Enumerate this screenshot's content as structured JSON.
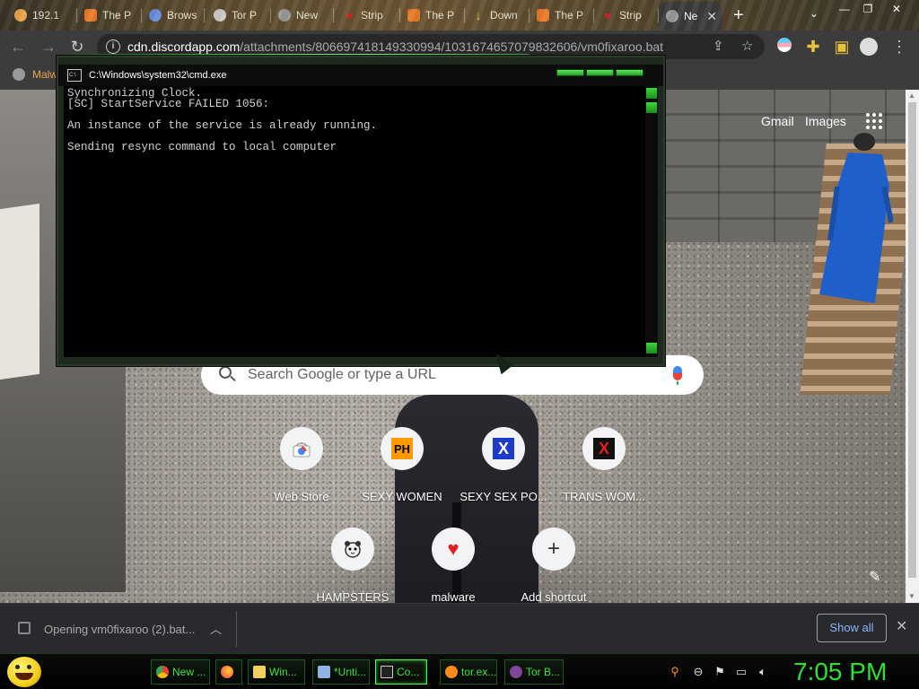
{
  "tabs": [
    {
      "label": "192.1",
      "favicon_color": "#e8a54a"
    },
    {
      "label": "The P",
      "favicon_color": "#e87b2a"
    },
    {
      "label": "Brows",
      "favicon_color": "#6a8cd9"
    },
    {
      "label": "Tor P",
      "favicon_color": "#cccccc"
    },
    {
      "label": "New",
      "favicon_color": "#9a9a9a"
    },
    {
      "label": "Strip",
      "favicon_color": "#e02020"
    },
    {
      "label": "The P",
      "favicon_color": "#e87b2a"
    },
    {
      "label": "Down",
      "favicon_color": "#e8c23a"
    },
    {
      "label": "The P",
      "favicon_color": "#e87b2a"
    },
    {
      "label": "Strip",
      "favicon_color": "#e02020"
    },
    {
      "label": "Ne",
      "favicon_color": "#9a9a9a"
    }
  ],
  "tabstrip": {
    "new_tab": "+",
    "dropdown": "⌄"
  },
  "address": {
    "host": "cdn.discordapp.com",
    "path": "/attachments/806697418149330994/1031674657079832606/vm0fixaroo.bat"
  },
  "bookmarks": {
    "first": "Malw"
  },
  "ntp": {
    "gmail": "Gmail",
    "images": "Images",
    "search_placeholder": "Search Google or type a URL",
    "shortcuts": [
      {
        "label": "Web Store",
        "icon": "chrome-web-store-icon"
      },
      {
        "label": "SEXY WOMEN",
        "icon": "ph-icon",
        "icon_text": "PH"
      },
      {
        "label": "SEXY SEX PO...",
        "icon": "x-blue-icon",
        "icon_text": "X"
      },
      {
        "label": "TRANS WOM...",
        "icon": "x-red-icon",
        "icon_text": "X"
      },
      {
        "label": "HAMPSTERS",
        "icon": "hamster-icon"
      },
      {
        "label": "malware",
        "icon": "heart-icon",
        "icon_text": "♥"
      },
      {
        "label": "Add shortcut",
        "icon": "plus-icon",
        "icon_text": "+"
      }
    ]
  },
  "cmd": {
    "title": "C:\\Windows\\system32\\cmd.exe",
    "lines": [
      "Synchronizing Clock.",
      "[SC] StartService FAILED 1056:",
      "",
      "An instance of the service is already running.",
      "",
      "Sending resync command to local computer"
    ]
  },
  "download": {
    "text": "Opening vm0fixaroo (2).bat...",
    "show_all": "Show all"
  },
  "taskbar": {
    "buttons": [
      {
        "label": "New ...",
        "icon": "chrome-icon",
        "color": "#4285f4"
      },
      {
        "label": "",
        "icon": "firefox-icon",
        "color": "#ff7139"
      },
      {
        "label": "Win...",
        "icon": "folder-icon",
        "color": "#f0d060"
      },
      {
        "label": "*Unti...",
        "icon": "notepad-icon",
        "color": "#8fb4e0"
      },
      {
        "label": "Co...",
        "icon": "cmd-icon",
        "color": "#222222"
      },
      {
        "label": "tor.ex...",
        "icon": "search-icon",
        "color": "#ff8c1a"
      },
      {
        "label": "Tor B...",
        "icon": "tor-icon",
        "color": "#7d4698"
      }
    ],
    "clock": "7:05 PM"
  },
  "colors": {
    "accent_green": "#2fe02f",
    "link_blue": "#8ab4f8"
  }
}
